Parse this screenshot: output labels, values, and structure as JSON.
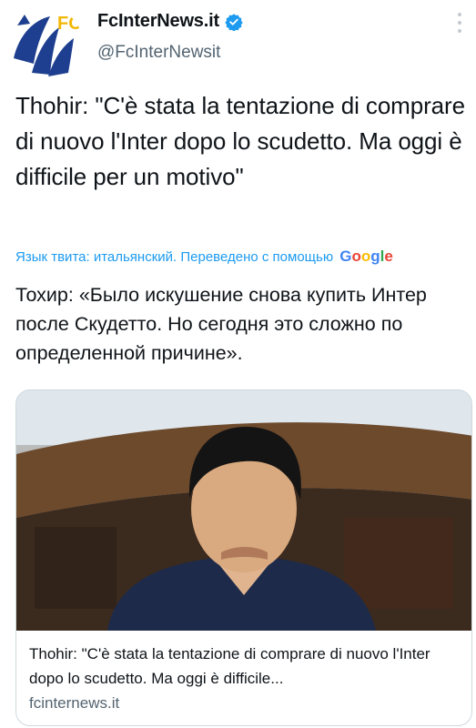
{
  "account": {
    "display_name": "FcInterNews.it",
    "handle": "@FcInterNewsit",
    "logo_text": "FC",
    "verified": true
  },
  "tweet": {
    "text": "Thohir: \"C'è stata la tentazione di comprare di nuovo l'Inter dopo lo scudetto. Ma oggi è difficile per un motivo\"",
    "translation_meta": "Язык твита: итальянский. Переведено с помощью",
    "translation_provider": "Google",
    "translated_text": "Тохир: «Было искушение снова купить Интер после Скудетто. Но сегодня это сложно по определенной причине»."
  },
  "card": {
    "image_description_icon": "photo-of-man",
    "title": "Thohir: \"C'è stata la tentazione di comprare di nuovo l'Inter dopo lo scudetto. Ma oggi è difficile...",
    "domain": "fcinternews.it"
  },
  "colors": {
    "accent": "#1d9bf0",
    "text": "#0f1419",
    "secondary": "#536471",
    "logo_blue": "#1e3f8f",
    "logo_gold": "#f2b705"
  }
}
